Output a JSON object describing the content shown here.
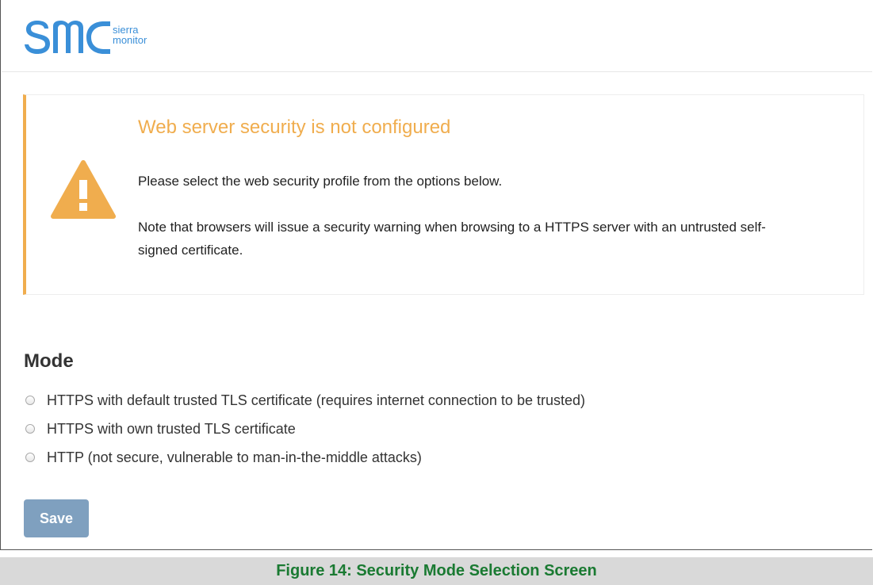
{
  "header": {
    "logo_text": "smc",
    "logo_sub_line1": "sierra",
    "logo_sub_line2": "monitor"
  },
  "alert": {
    "icon": "warning-triangle-icon",
    "title": "Web server security is not configured",
    "message1": "Please select the web security profile from the options below.",
    "message2": "Note that browsers will issue a security warning when browsing to a HTTPS server with an untrusted self-signed certificate."
  },
  "mode": {
    "title": "Mode",
    "options": [
      {
        "label": "HTTPS with default trusted TLS certificate (requires internet connection to be trusted)",
        "selected": false
      },
      {
        "label": "HTTPS with own trusted TLS certificate",
        "selected": false
      },
      {
        "label": "HTTP (not secure, vulnerable to man-in-the-middle attacks)",
        "selected": false
      }
    ]
  },
  "buttons": {
    "save_label": "Save"
  },
  "caption": "Figure 14: Security Mode Selection Screen",
  "colors": {
    "brand_blue": "#3a8fd8",
    "warning": "#f0ad4e",
    "button": "#7fa0bf",
    "caption_text": "#1a7a32",
    "caption_bg": "#d9d9d9"
  }
}
